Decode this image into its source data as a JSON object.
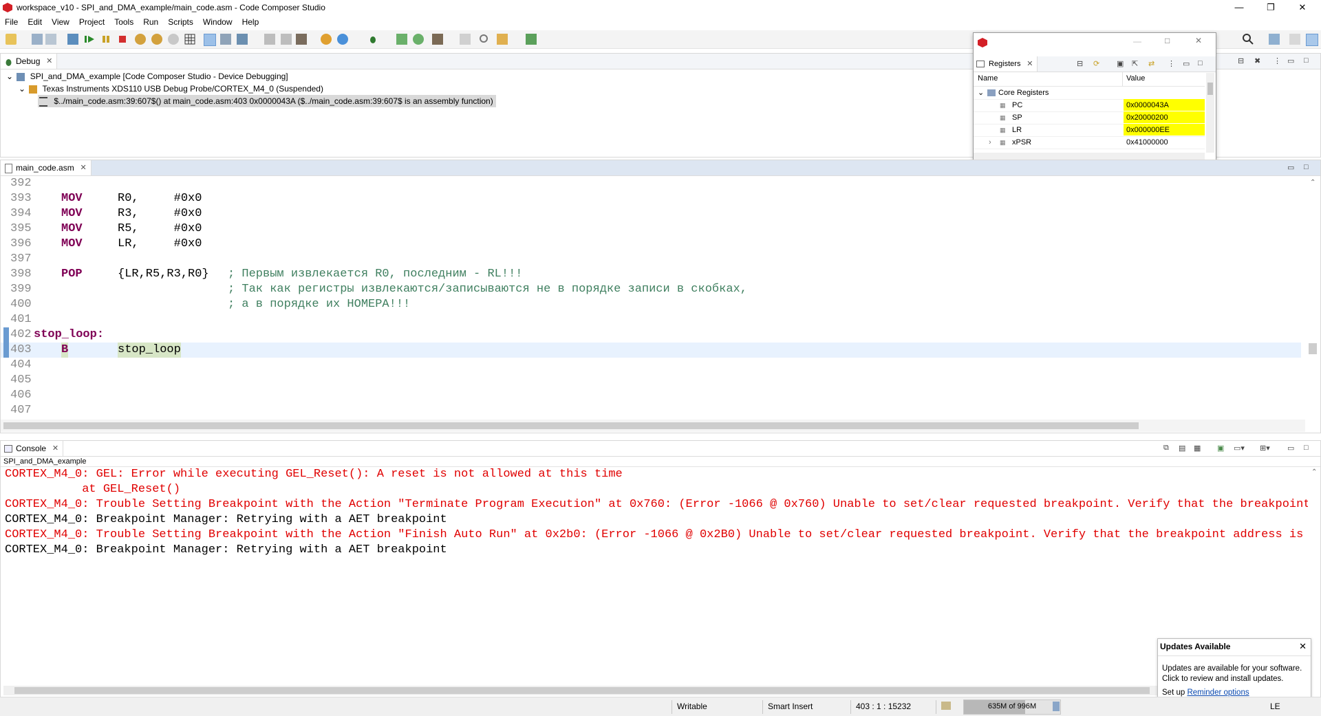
{
  "window": {
    "title": "workspace_v10 - SPI_and_DMA_example/main_code.asm - Code Composer Studio",
    "minimize": "—",
    "maximize": "❐",
    "close": "✕"
  },
  "menu": [
    "File",
    "Edit",
    "View",
    "Project",
    "Tools",
    "Run",
    "Scripts",
    "Window",
    "Help"
  ],
  "debug": {
    "tab_label": "Debug",
    "rows": [
      "SPI_and_DMA_example [Code Composer Studio - Device Debugging]",
      "Texas Instruments XDS110 USB Debug Probe/CORTEX_M4_0 (Suspended)",
      "$../main_code.asm:39:607$() at main_code.asm:403 0x0000043A   ($../main_code.asm:39:607$ is an assembly function)"
    ]
  },
  "registers": {
    "tab_label": "Registers",
    "col_name": "Name",
    "col_value": "Value",
    "group": "Core Registers",
    "items": [
      {
        "name": "PC",
        "value": "0x0000043A",
        "changed": true
      },
      {
        "name": "SP",
        "value": "0x20000200",
        "changed": true
      },
      {
        "name": "LR",
        "value": "0x000000EE",
        "changed": true
      },
      {
        "name": "xPSR",
        "value": "0x41000000",
        "changed": false
      }
    ]
  },
  "editor": {
    "tab_label": "main_code.asm",
    "lines": [
      {
        "num": "392",
        "text": ""
      },
      {
        "num": "393",
        "mnem": "MOV",
        "ops": "R0,     #0x0"
      },
      {
        "num": "394",
        "mnem": "MOV",
        "ops": "R3,     #0x0"
      },
      {
        "num": "395",
        "mnem": "MOV",
        "ops": "R5,     #0x0"
      },
      {
        "num": "396",
        "mnem": "MOV",
        "ops": "LR,     #0x0"
      },
      {
        "num": "397",
        "text": ""
      },
      {
        "num": "398",
        "mnem": "POP",
        "ops": "{LR,R5,R3,R0}",
        "comment": "; Первым извлекается R0, последним - RL!!!"
      },
      {
        "num": "399",
        "comment": "; Так как регистры извлекаются/записываются не в порядке записи в скобках,"
      },
      {
        "num": "400",
        "comment": "; а в порядке их НОМЕРА!!!"
      },
      {
        "num": "401",
        "text": ""
      },
      {
        "num": "402",
        "label": "stop_loop:"
      },
      {
        "num": "403",
        "mnem": "B",
        "ops": "stop_loop",
        "current": true
      },
      {
        "num": "404",
        "text": ""
      },
      {
        "num": "405",
        "text": ""
      },
      {
        "num": "406",
        "text": ""
      },
      {
        "num": "407",
        "text": ""
      }
    ]
  },
  "console": {
    "tab_label": "Console",
    "session": "SPI_and_DMA_example",
    "lines": [
      {
        "text": "CORTEX_M4_0: GEL: Error while executing GEL_Reset(): A reset is not allowed at this time",
        "error": true
      },
      {
        "text": "           at GEL_Reset()",
        "error": true
      },
      {
        "text": "CORTEX_M4_0: Trouble Setting Breakpoint with the Action \"Terminate Program Execution\" at 0x760: (Error -1066 @ 0x760) Unable to set/clear requested breakpoint. Verify that the breakpoint add",
        "error": true
      },
      {
        "text": "CORTEX_M4_0: Breakpoint Manager: Retrying with a AET breakpoint",
        "error": false
      },
      {
        "text": "CORTEX_M4_0: Trouble Setting Breakpoint with the Action \"Finish Auto Run\" at 0x2b0: (Error -1066 @ 0x2B0) Unable to set/clear requested breakpoint. Verify that the breakpoint address is in v",
        "error": true
      },
      {
        "text": "CORTEX_M4_0: Breakpoint Manager: Retrying with a AET breakpoint",
        "error": false
      }
    ]
  },
  "notification": {
    "title": "Updates Available",
    "body": "Updates are available for your software. Click to review and install updates.",
    "setup_prefix": "Set up ",
    "setup_link": "Reminder options"
  },
  "status": {
    "writable": "Writable",
    "insert_mode": "Smart Insert",
    "position": "403 : 1 : 15232",
    "memory": "635M of 996M",
    "line_ending": "LE"
  },
  "colors": {
    "changed_register": "#ffff00",
    "error_text": "#e00000",
    "keyword": "#7f0055",
    "comment": "#3f7f5f",
    "current_line": "#e8f2fe"
  }
}
